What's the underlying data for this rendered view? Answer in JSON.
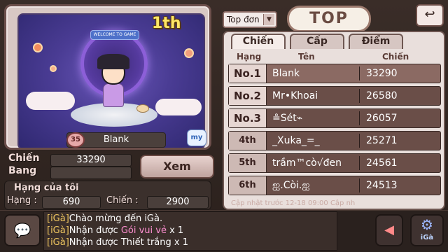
{
  "profile": {
    "rank_label": "1th",
    "portal_banner": "WELCOME TO GAME",
    "level": "35",
    "name": "Blank",
    "my_badge": "my"
  },
  "stats": {
    "chien_label": "Chiến",
    "chien_value": "33290",
    "bang_label": "Bang",
    "bang_value": "",
    "xem_label": "Xem",
    "mine_title": "Hạng của tôi",
    "hang_label": "Hạng :",
    "hang_value": "690",
    "chien2_label": "Chiến :",
    "chien2_value": "2900"
  },
  "top": {
    "select_value": "Top đơn",
    "select_arrow": "▼",
    "title": "TOP",
    "back_icon": "↩",
    "tabs": [
      "Chiến",
      "Cấp",
      "Điểm"
    ],
    "headers": {
      "rank": "Hạng",
      "name": "Tên",
      "power": "Chiến"
    },
    "rows": [
      {
        "rank": "No.1",
        "name": "Blank",
        "power": "33290"
      },
      {
        "rank": "No.2",
        "name": "Mr•Khoai",
        "power": "26580"
      },
      {
        "rank": "No.3",
        "name": "≗Sét⌁",
        "power": "26057"
      },
      {
        "rank": "4th",
        "name": "_Xuka_=_",
        "power": "25271"
      },
      {
        "rank": "5th",
        "name": "trầm™cò√đen",
        "power": "24561"
      },
      {
        "rank": "6th",
        "name": "ஐ.Còi.ஐ",
        "power": "24513"
      }
    ],
    "update_text": "Cập nhật trước 12-18 09:00 Cập nh"
  },
  "chat": {
    "icon": "💬",
    "lines": [
      {
        "tag": "[iGà]",
        "msg": "Chào mừng đến iGà.",
        "pink": "",
        "tail": ""
      },
      {
        "tag": "[iGà]",
        "msg": "Nhận được ",
        "pink": "Gói vui vẻ",
        "tail": " x 1"
      },
      {
        "tag": "[iGà]",
        "msg": "Nhận được ",
        "pink": "",
        "tail": "Thiết trắng x 1"
      }
    ],
    "arrow_icon": "◀",
    "iga_label": "iGà",
    "gear_icon": "⚙"
  },
  "colors": {
    "accent_gold": "#ffe766",
    "panel_bg": "#e9dfdc",
    "row_bg": "#6a4e48",
    "chat_tag": "#f0c760",
    "chat_pink": "#ff8fd2"
  }
}
